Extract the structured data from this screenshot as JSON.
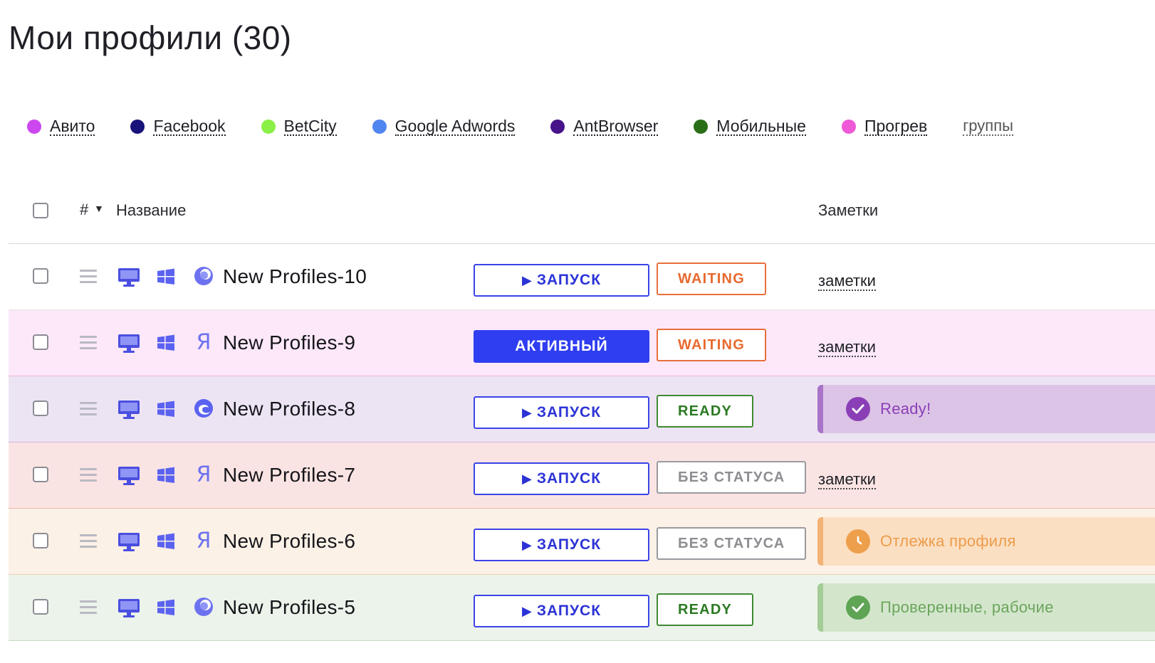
{
  "page": {
    "title": "Мои профили (30)"
  },
  "groups": [
    {
      "label": "Авито",
      "color": "#cc47f0"
    },
    {
      "label": "Facebook",
      "color": "#17137a"
    },
    {
      "label": "BetCity",
      "color": "#8af046"
    },
    {
      "label": "Google Adwords",
      "color": "#4f86f0"
    },
    {
      "label": "AntBrowser",
      "color": "#46138a"
    },
    {
      "label": "Мобильные",
      "color": "#2a6e17"
    },
    {
      "label": "Прогрев",
      "color": "#ee5ad8"
    }
  ],
  "groups_link": "группы",
  "table": {
    "header": {
      "hash": "#",
      "name": "Название",
      "notes": "Заметки"
    },
    "rows": [
      {
        "name": "New Profiles-10",
        "browser_icon": "ant-browser-icon",
        "bg": "#ffffff",
        "border": "#e3e3e8",
        "launch_label": "ЗАПУСК",
        "launch_active": false,
        "status": "WAITING",
        "status_color": "#e8692f",
        "status_border": "#e86f3c",
        "note": "заметки"
      },
      {
        "name": "New Profiles-9",
        "browser_icon": "yandex-browser-icon",
        "bg": "#fce8f8",
        "border": "#e9b6e2",
        "launch_label": "АКТИВНЫЙ",
        "launch_active": true,
        "status": "WAITING",
        "status_color": "#e8692f",
        "status_border": "#e86f3c",
        "note": "заметки"
      },
      {
        "name": "New Profiles-8",
        "browser_icon": "edge-browser-icon",
        "bg": "#ede4f3",
        "border": "#d5b5d8",
        "launch_label": "ЗАПУСК",
        "launch_active": false,
        "status": "READY",
        "status_color": "#2b7a22",
        "status_border": "#3e8a32",
        "note_card": {
          "text": "Ready!",
          "bg": "#dcc4e6",
          "accent": "#a874c8",
          "text_color": "#8b3fb7",
          "icon_bg": "#8b3fb7",
          "icon": "check-icon"
        }
      },
      {
        "name": "New Profiles-7",
        "browser_icon": "yandex-browser-icon",
        "bg": "#fae4e3",
        "border": "#eab7ad",
        "launch_label": "ЗАПУСК",
        "launch_active": false,
        "status": "БЕЗ СТАТУСА",
        "status_color": "#8d8d92",
        "status_border": "#9a9aa0",
        "note": "заметки"
      },
      {
        "name": "New Profiles-6",
        "browser_icon": "yandex-browser-icon",
        "bg": "#fcf1e6",
        "border": "#eccdb2",
        "launch_label": "ЗАПУСК",
        "launch_active": false,
        "status": "БЕЗ СТАТУСА",
        "status_color": "#8d8d92",
        "status_border": "#9a9aa0",
        "note_card": {
          "text": "Отлежка профиля",
          "bg": "#fbdfc2",
          "accent": "#f2b377",
          "text_color": "#ec9c4b",
          "icon_bg": "#ee9f4c",
          "icon": "clock-icon"
        }
      },
      {
        "name": "New Profiles-5",
        "browser_icon": "ant-browser-icon",
        "bg": "#ecf3ea",
        "border": "#c3dcbc",
        "launch_label": "ЗАПУСК",
        "launch_active": false,
        "status": "READY",
        "status_color": "#2b7a22",
        "status_border": "#3e8a32",
        "note_card": {
          "text": "Проверенные, рабочие",
          "bg": "#d3e6cc",
          "accent": "#a4cc96",
          "text_color": "#6ca55c",
          "icon_bg": "#5fa455",
          "icon": "check-icon"
        }
      }
    ]
  }
}
